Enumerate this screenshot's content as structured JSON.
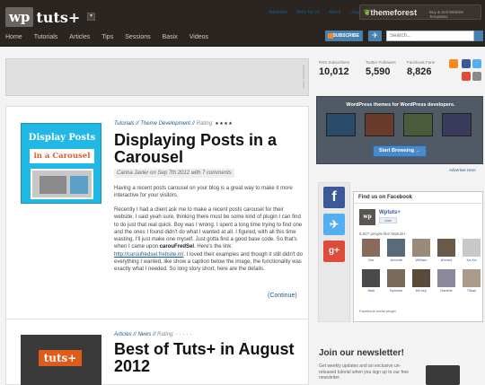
{
  "header": {
    "logo_wp": "wp",
    "logo_tuts": "tuts+",
    "top_links": [
      "Advertise",
      "Write for Us",
      "About",
      "Usage"
    ],
    "themeforest_logo": "themeforest",
    "themeforest_tagline": "Buy & Sell Website Templates",
    "nav": [
      "Home",
      "Tutorials",
      "Articles",
      "Tips",
      "Sessions",
      "Basix",
      "Videos"
    ],
    "subscribe_label": "SUBSCRIBE",
    "search_placeholder": "Search..."
  },
  "ad_banner": {
    "tag": "Advertise Here"
  },
  "stats": [
    {
      "label": "RSS Subscribers",
      "value": "10,012"
    },
    {
      "label": "Twitter Followers",
      "value": "5,590"
    },
    {
      "label": "Facebook Fans",
      "value": "8,826"
    }
  ],
  "posts": [
    {
      "thumb_line1": "Display Posts",
      "thumb_line2": "in a Carousel",
      "category": "Tutorials",
      "subcategory": "Theme Development",
      "rating_label": "Rating:",
      "stars": "★★★★",
      "title": "Displaying Posts in a Carousel",
      "byline": "Carina Javier on Sep 7th 2012 with 7 comments",
      "intro": "Having a recent posts carousel on your blog is a great way to make it more interactive for your visitors.",
      "body_before": "Recently I had a client ask me to make a recent posts carousel for their website. I said yeah sure, thinking there must be some kind of plugin I can find to do just that real quick. Boy was I wrong. I spent a long time trying to find one and the ones I found didn't do what I wanted at all. I figured, with all this time wasting, I'll just make one myself. Just gotta find a good base code. So that's when I came upon ",
      "body_bold": "carouFredSel",
      "body_link_prefix": ". Here's the link: ",
      "body_link": "http://caroufredsel.frebsite.nl/",
      "body_after": ". I loved their examples and though it still didn't do everything I wanted, like show a caption below the image, the functionality was exactly what I needed. So long story short, here are the details.",
      "continue_label": "(Continue)"
    },
    {
      "thumb_text": "tuts+",
      "category": "Articles",
      "subcategory": "News",
      "rating_label": "Rating:",
      "stars": "· · · · ·",
      "title": "Best of Tuts+ in August 2012"
    }
  ],
  "ad_block": {
    "title": "WordPress themes for WordPress developers.",
    "button": "Start Browsing →",
    "advertise_here": "Advertise Here"
  },
  "facebook": {
    "header": "Find us on Facebook",
    "page_logo": "wp",
    "page_name": "Wptuts+",
    "like_label": "Like",
    "fan_count": "8,827 people like Wptuts+.",
    "fans": [
      "Om",
      "Jehonte",
      "William",
      "Ahmed",
      "Ka Ka",
      "Jitak",
      "Syamim",
      "Bil bey",
      "Daniele",
      "Tilkan"
    ],
    "plugin_label": "Facebook social plugin"
  },
  "newsletter": {
    "title": "Join our newsletter!",
    "text": "Get weekly updates and an exclusive un-released tutorial when you sign up to our free newsletter."
  },
  "colors": {
    "header_bg": "#2a2520",
    "link": "#1a5a8a",
    "accent_blue": "#4a80ae",
    "rss": "#f78a1d"
  }
}
